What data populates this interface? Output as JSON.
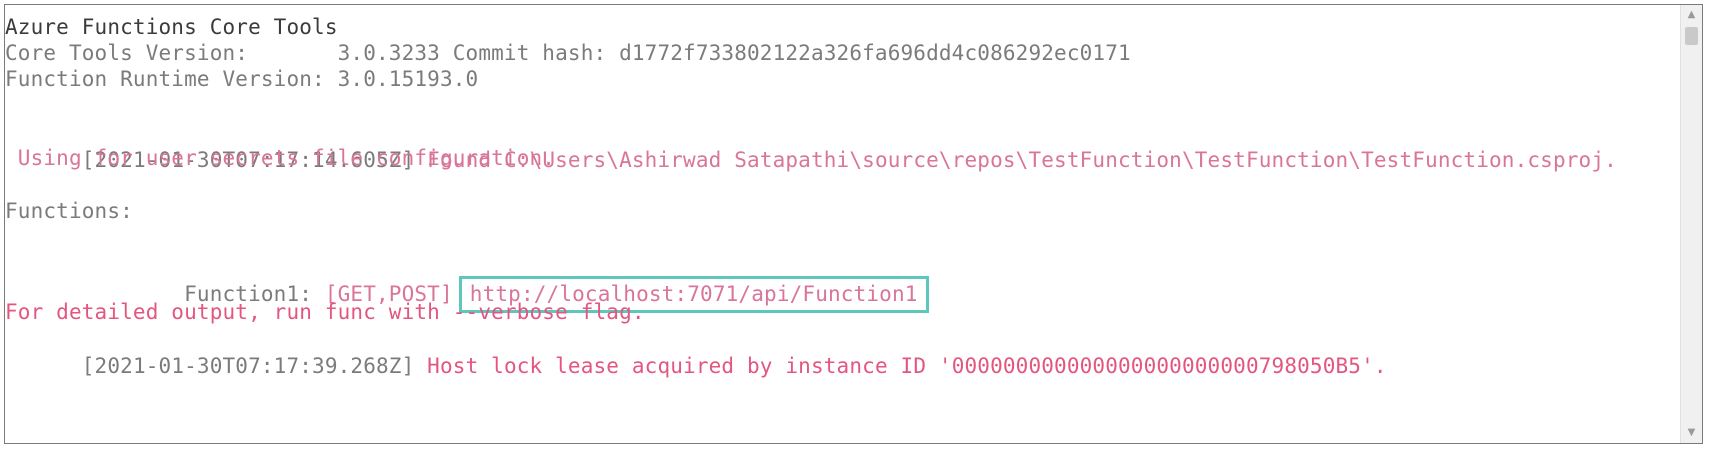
{
  "console": {
    "header": {
      "title": "Azure Functions Core Tools",
      "core_tools_version": "Core Tools Version:       3.0.3233 Commit hash: d1772f733802122a326fa696dd4c086292ec0171",
      "runtime_version": "Function Runtime Version: 3.0.15193.0"
    },
    "log1": {
      "timestamp": "[2021-01-30T07:17:14.605Z]",
      "message": " Found C:\\Users\\Ashirwad Satapathi\\source\\repos\\TestFunction\\TestFunction\\TestFunction.csproj.",
      "continuation": " Using for user secrets file configuration."
    },
    "functions": {
      "heading": "Functions:",
      "function_name": "        Function1:",
      "methods": " [GET,POST]",
      "url": "http://localhost:7071/api/Function1"
    },
    "hint": "For detailed output, run func with --verbose flag.",
    "log2": {
      "timestamp": "[2021-01-30T07:17:39.268Z]",
      "message": " Host lock lease acquired by instance ID '000000000000000000000000798050B5'."
    }
  },
  "colors": {
    "default_text": "#3b3b3b",
    "info_text": "#d9759a",
    "warning_text": "#e3567f",
    "highlight_border": "#5ec6bd"
  },
  "scrollbar": {
    "up_icon": "triangle-up-icon",
    "down_icon": "triangle-down-icon"
  }
}
